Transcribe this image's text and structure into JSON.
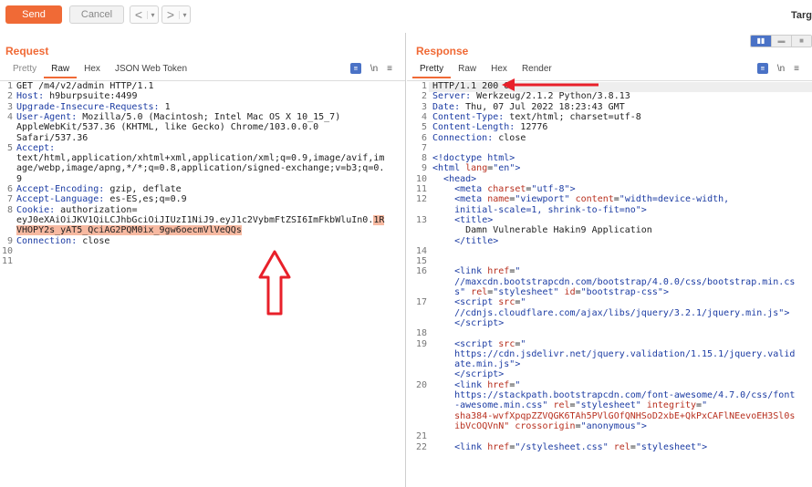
{
  "toolbar": {
    "send_label": "Send",
    "cancel_label": "Cancel",
    "back_arrow": "<",
    "forward_arrow": ">",
    "caret": "▾",
    "target_label": "Targ"
  },
  "request": {
    "title": "Request",
    "tabs": [
      "Pretty",
      "Raw",
      "Hex",
      "JSON Web Token"
    ],
    "active_tab": "Raw",
    "wrap_icon": "\\n",
    "menu_icon": "≡",
    "lines": [
      {
        "n": "1",
        "text": "GET /m4/v2/admin HTTP/1.1"
      },
      {
        "n": "2",
        "key": "Host:",
        "text": " h9burpsuite:4499"
      },
      {
        "n": "3",
        "key": "Upgrade-Insecure-Requests:",
        "text": " 1"
      },
      {
        "n": "4",
        "key": "User-Agent:",
        "text": " Mozilla/5.0 (Macintosh; Intel Mac OS X 10_15_7)"
      },
      {
        "n": "",
        "text": "AppleWebKit/537.36 (KHTML, like Gecko) Chrome/103.0.0.0"
      },
      {
        "n": "",
        "text": "Safari/537.36"
      },
      {
        "n": "5",
        "key": "Accept:",
        "text": ""
      },
      {
        "n": "",
        "text": "text/html,application/xhtml+xml,application/xml;q=0.9,image/avif,im"
      },
      {
        "n": "",
        "text": "age/webp,image/apng,*/*;q=0.8,application/signed-exchange;v=b3;q=0."
      },
      {
        "n": "",
        "text": "9"
      },
      {
        "n": "6",
        "key": "Accept-Encoding:",
        "text": " gzip, deflate"
      },
      {
        "n": "7",
        "key": "Accept-Language:",
        "text": " es-ES,es;q=0.9"
      },
      {
        "n": "8",
        "key": "Cookie:",
        "text": " authorization="
      },
      {
        "n": "",
        "text": "eyJ0eXAiOiJKV1QiLCJhbGciOiJIUzI1NiJ9.eyJ1c2VybmFtZSI6ImFkbWluIn0.",
        "hl": "1R"
      },
      {
        "n": "",
        "hl2": "VHOPY2s_yAT5_QciAG2PQM0ix_9gw6oecmVlVeQQs"
      },
      {
        "n": "9",
        "key": "Connection:",
        "text": " close"
      },
      {
        "n": "10",
        "text": ""
      },
      {
        "n": "11",
        "text": ""
      }
    ]
  },
  "response": {
    "title": "Response",
    "tabs": [
      "Pretty",
      "Raw",
      "Hex",
      "Render"
    ],
    "active_tab": "Pretty",
    "wrap_icon": "\\n",
    "menu_icon": "≡",
    "lines": [
      {
        "n": "1",
        "text": "HTTP/1.1 200 OK"
      },
      {
        "n": "2",
        "key": "Server:",
        "text": " Werkzeug/2.1.2 Python/3.8.13"
      },
      {
        "n": "3",
        "key": "Date:",
        "text": " Thu, 07 Jul 2022 18:23:43 GMT"
      },
      {
        "n": "4",
        "key": "Content-Type:",
        "text": " text/html; charset=utf-8"
      },
      {
        "n": "5",
        "key": "Content-Length:",
        "text": " 12776"
      },
      {
        "n": "6",
        "key": "Connection:",
        "text": " close"
      },
      {
        "n": "7",
        "text": ""
      },
      {
        "n": "8",
        "html": "<span class='tag'>&lt;!doctype html&gt;</span>"
      },
      {
        "n": "9",
        "html": "<span class='tag'>&lt;html</span> <span class='attr'>lang</span>=<span class='str'>\"en\"</span><span class='tag'>&gt;</span>"
      },
      {
        "n": "10",
        "html": "  <span class='tag'>&lt;head&gt;</span>"
      },
      {
        "n": "11",
        "html": "    <span class='tag'>&lt;meta</span> <span class='attr'>charset</span>=<span class='str'>\"utf-8\"</span><span class='tag'>&gt;</span>"
      },
      {
        "n": "12",
        "html": "    <span class='tag'>&lt;meta</span> <span class='attr'>name</span>=<span class='str'>\"viewport\"</span> <span class='attr'>content</span>=<span class='str'>\"width=device-width,</span>"
      },
      {
        "n": "",
        "html": "    <span class='str'>initial-scale=1, shrink-to-fit=no\"</span><span class='tag'>&gt;</span>"
      },
      {
        "n": "13",
        "html": "    <span class='tag'>&lt;title&gt;</span>"
      },
      {
        "n": "",
        "html": "      Damn Vulnerable Hakin9 Application"
      },
      {
        "n": "",
        "html": "    <span class='tag'>&lt;/title&gt;</span>"
      },
      {
        "n": "14",
        "html": ""
      },
      {
        "n": "15",
        "html": ""
      },
      {
        "n": "16",
        "html": "    <span class='tag'>&lt;link</span> <span class='attr'>href</span>=<span class='str'>\"</span>"
      },
      {
        "n": "",
        "html": "    <span class='str'>//maxcdn.bootstrapcdn.com/bootstrap/4.0.0/css/bootstrap.min.cs</span>"
      },
      {
        "n": "",
        "html": "    <span class='str'>s\"</span> <span class='attr'>rel</span>=<span class='str'>\"stylesheet\"</span> <span class='attr'>id</span>=<span class='str'>\"bootstrap-css\"</span><span class='tag'>&gt;</span>"
      },
      {
        "n": "17",
        "html": "    <span class='tag'>&lt;script</span> <span class='attr'>src</span>=<span class='str'>\"</span>"
      },
      {
        "n": "",
        "html": "    <span class='str'>//cdnjs.cloudflare.com/ajax/libs/jquery/3.2.1/jquery.min.js\"</span><span class='tag'>&gt;</span>"
      },
      {
        "n": "",
        "html": "    <span class='tag'>&lt;/script&gt;</span>"
      },
      {
        "n": "18",
        "html": ""
      },
      {
        "n": "19",
        "html": "    <span class='tag'>&lt;script</span> <span class='attr'>src</span>=<span class='str'>\"</span>"
      },
      {
        "n": "",
        "html": "    <span class='str'>https://cdn.jsdelivr.net/jquery.validation/1.15.1/jquery.valid</span>"
      },
      {
        "n": "",
        "html": "    <span class='str'>ate.min.js\"</span><span class='tag'>&gt;</span>"
      },
      {
        "n": "",
        "html": "    <span class='tag'>&lt;/script&gt;</span>"
      },
      {
        "n": "20",
        "html": "    <span class='tag'>&lt;link</span> <span class='attr'>href</span>=<span class='str'>\"</span>"
      },
      {
        "n": "",
        "html": "    <span class='str'>https://stackpath.bootstrapcdn.com/font-awesome/4.7.0/css/font</span>"
      },
      {
        "n": "",
        "html": "    <span class='str'>-awesome.min.css\"</span> <span class='attr'>rel</span>=<span class='str'>\"stylesheet\"</span> <span class='attr'>integrity</span>=<span class='str'>\"</span>"
      },
      {
        "n": "",
        "html": "    <span class='red'>sha384-wvfXpqpZZVQGK6TAh5PVlGOfQNHSoD2xbE+QkPxCAFlNEevoEH3Sl0s</span>"
      },
      {
        "n": "",
        "html": "    <span class='red'>ibVcOQVnN\"</span> <span class='attr'>crossorigin</span>=<span class='str'>\"anonymous\"</span><span class='tag'>&gt;</span>"
      },
      {
        "n": "21",
        "html": ""
      },
      {
        "n": "22",
        "html": "    <span class='tag'>&lt;link</span> <span class='attr'>href</span>=<span class='str'>\"/stylesheet.css\"</span> <span class='attr'>rel</span>=<span class='str'>\"stylesheet\"</span><span class='tag'>&gt;</span>"
      }
    ]
  },
  "colors": {
    "accent": "#f06a36",
    "annotation": "#e8202a",
    "highlight": "#f7b9a1",
    "keyword": "#1c3ca3"
  }
}
